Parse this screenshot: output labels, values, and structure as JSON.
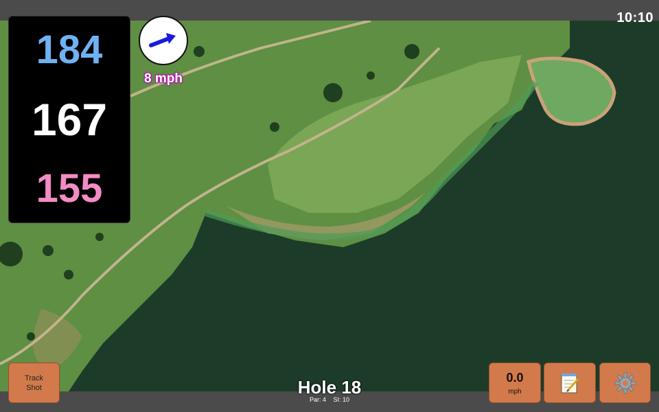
{
  "status": {
    "time": "10:10"
  },
  "distances": {
    "back": "184",
    "middle": "167",
    "front": "155"
  },
  "wind": {
    "speed": "8 mph",
    "icon": "wind-arrow-icon"
  },
  "hole": {
    "title": "Hole 18",
    "par": "Par: 4",
    "stroke_index": "SI: 10"
  },
  "buttons": {
    "track_shot_line1": "Track",
    "track_shot_line2": "Shot",
    "speed_value": "0.0",
    "speed_unit": "mph",
    "notes_icon": "notepad-icon",
    "settings_icon": "gear-icon"
  },
  "colors": {
    "back_distance": "#6fb2f2",
    "middle_distance": "#ffffff",
    "front_distance": "#f28cc4",
    "button": "#d27a4c",
    "wind_arrow": "#1a1ae0"
  }
}
